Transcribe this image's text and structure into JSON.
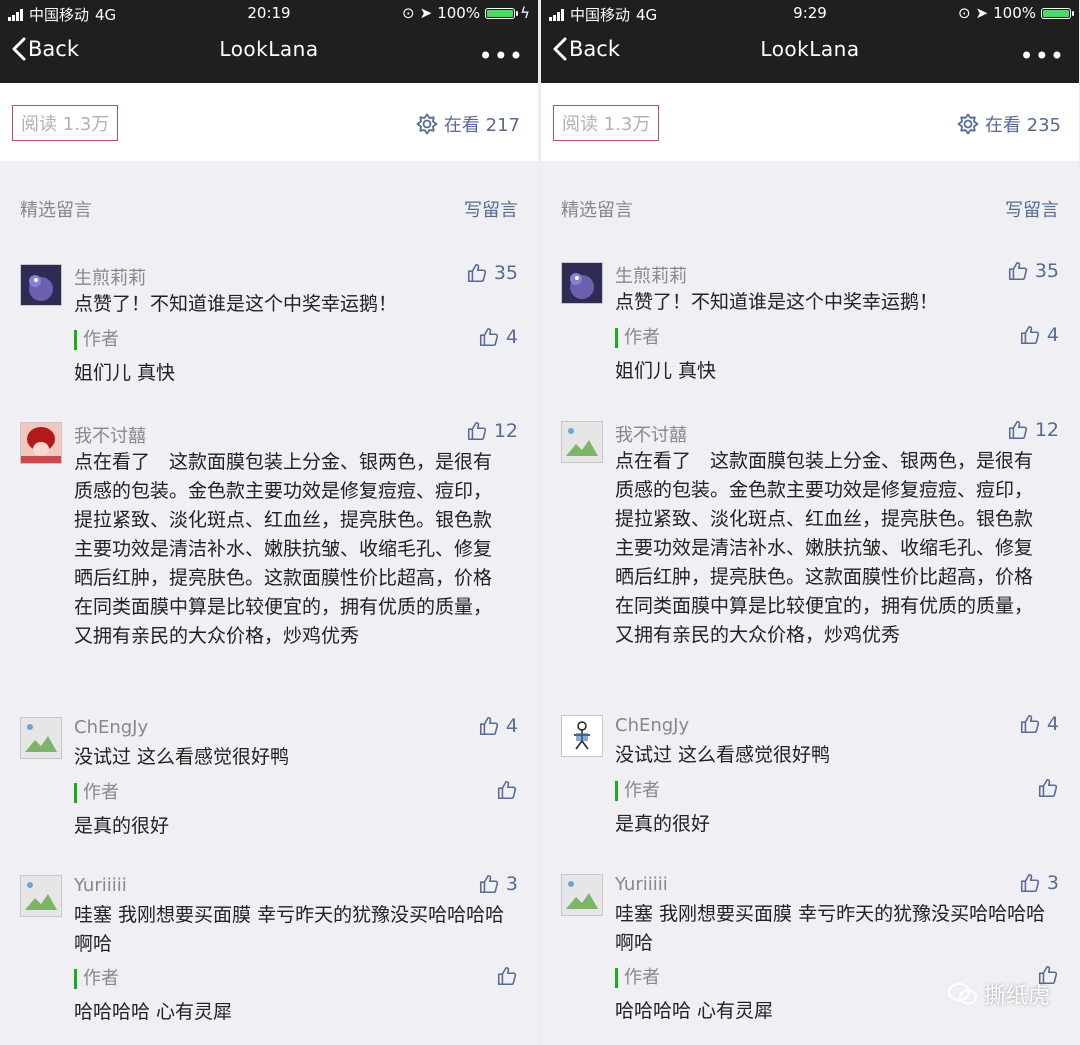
{
  "colors": {
    "bar": "#1f1f1f",
    "link": "#576b95",
    "author": "#1aad19",
    "battery": "#4cd964"
  },
  "screens": [
    {
      "status": {
        "carrier": "中国移动",
        "network": "4G",
        "time": "20:19",
        "battery": "100%"
      },
      "nav": {
        "back": "Back",
        "title": "LookLana",
        "more": "•••"
      },
      "reads": "阅读 1.3万",
      "watching": "在看 217",
      "section": {
        "title": "精选留言",
        "write": "写留言"
      },
      "comments": [
        {
          "nick": "生煎莉莉",
          "likes": "35",
          "text": "点赞了！不知道谁是这个中奖幸运鹅！",
          "author": "作者",
          "reply_likes": "4",
          "reply": "姐们儿 真快"
        },
        {
          "nick": "我不讨囍",
          "likes": "12",
          "text": "点在看了　这款面膜包装上分金、银两色，是很有质感的包装。金色款主要功效是修复痘痘、痘印，提拉紧致、淡化斑点、红血丝，提亮肤色。银色款主要功效是清洁补水、嫩肤抗皱、收缩毛孔、修复晒后红肿，提亮肤色。这款面膜性价比超高，价格在同类面膜中算是比较便宜的，拥有优质的质量，又拥有亲民的大众价格，炒鸡优秀"
        },
        {
          "nick": "ChEngJy",
          "likes": "4",
          "text": "没试过 这么看感觉很好鸭",
          "author": "作者",
          "reply_likes": "",
          "reply": "是真的很好"
        },
        {
          "nick": "Yuriiiii",
          "likes": "3",
          "text": "哇塞 我刚想要买面膜 幸亏昨天的犹豫没买哈哈哈哈啊哈",
          "author": "作者",
          "reply_likes": "",
          "reply": "哈哈哈哈 心有灵犀"
        }
      ]
    },
    {
      "status": {
        "carrier": "中国移动",
        "network": "4G",
        "time": "9:29",
        "battery": "100%"
      },
      "nav": {
        "back": "Back",
        "title": "LookLana",
        "more": "•••"
      },
      "reads": "阅读 1.3万",
      "watching": "在看 235",
      "section": {
        "title": "精选留言",
        "write": "写留言"
      },
      "comments": [
        {
          "nick": "生煎莉莉",
          "likes": "35",
          "text": "点赞了！不知道谁是这个中奖幸运鹅！",
          "author": "作者",
          "reply_likes": "4",
          "reply": "姐们儿 真快"
        },
        {
          "nick": "我不讨囍",
          "likes": "12",
          "text": "点在看了　这款面膜包装上分金、银两色，是很有质感的包装。金色款主要功效是修复痘痘、痘印，提拉紧致、淡化斑点、红血丝，提亮肤色。银色款主要功效是清洁补水、嫩肤抗皱、收缩毛孔、修复晒后红肿，提亮肤色。这款面膜性价比超高，价格在同类面膜中算是比较便宜的，拥有优质的质量，又拥有亲民的大众价格，炒鸡优秀"
        },
        {
          "nick": "ChEngJy",
          "likes": "4",
          "text": "没试过 这么看感觉很好鸭",
          "author": "作者",
          "reply_likes": "",
          "reply": "是真的很好"
        },
        {
          "nick": "Yuriiiii",
          "likes": "3",
          "text": "哇塞 我刚想要买面膜 幸亏昨天的犹豫没买哈哈哈哈啊哈",
          "author": "作者",
          "reply_likes": "",
          "reply": "哈哈哈哈 心有灵犀"
        }
      ]
    }
  ],
  "watermark": "撕纸虎"
}
